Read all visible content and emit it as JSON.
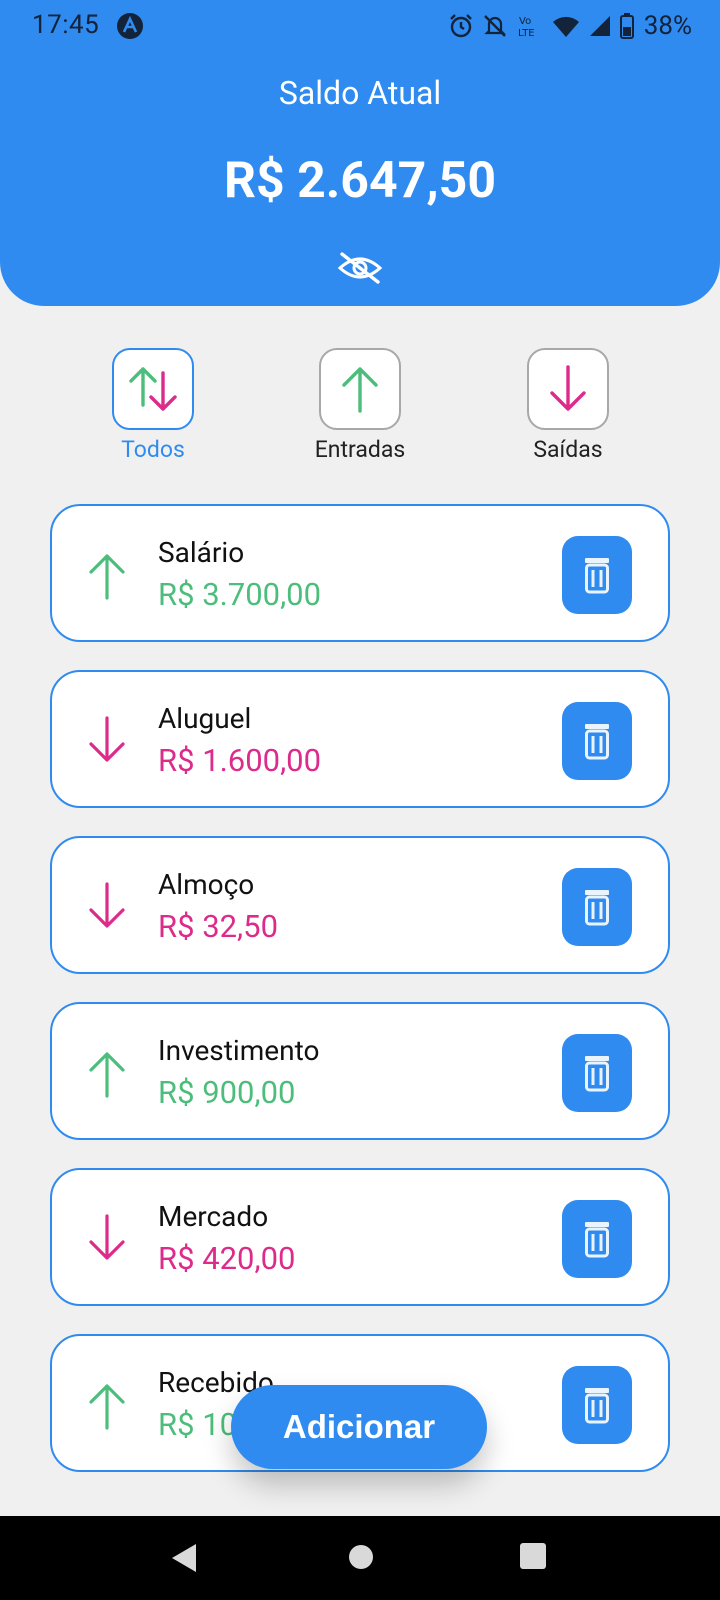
{
  "status_bar": {
    "time": "17:45",
    "battery": "38%",
    "icons": [
      "app-a-icon",
      "alarm-icon",
      "mute-icon",
      "volte-icon",
      "wifi-icon",
      "signal-icon",
      "battery-icon"
    ]
  },
  "header": {
    "title": "Saldo Atual",
    "balance": "R$ 2.647,50",
    "hide_icon": "eye-off-icon"
  },
  "filters": [
    {
      "label": "Todos",
      "icon": "up-down-arrows-icon",
      "active": true
    },
    {
      "label": "Entradas",
      "icon": "arrow-up-icon",
      "active": false
    },
    {
      "label": "Saídas",
      "icon": "arrow-down-icon",
      "active": false
    }
  ],
  "transactions": [
    {
      "name": "Salário",
      "amount": "R$ 3.700,00",
      "type": "in"
    },
    {
      "name": "Aluguel",
      "amount": "R$ 1.600,00",
      "type": "out"
    },
    {
      "name": "Almoço",
      "amount": "R$ 32,50",
      "type": "out"
    },
    {
      "name": "Investimento",
      "amount": "R$ 900,00",
      "type": "in"
    },
    {
      "name": "Mercado",
      "amount": "R$ 420,00",
      "type": "out"
    },
    {
      "name": "Recebido",
      "amount": "R$ 10",
      "type": "in"
    }
  ],
  "add_button": {
    "label": "Adicionar"
  },
  "colors": {
    "primary": "#2f8bef",
    "income": "#4cbd7a",
    "expense": "#dc2b8a",
    "background": "#f0f0f0"
  }
}
